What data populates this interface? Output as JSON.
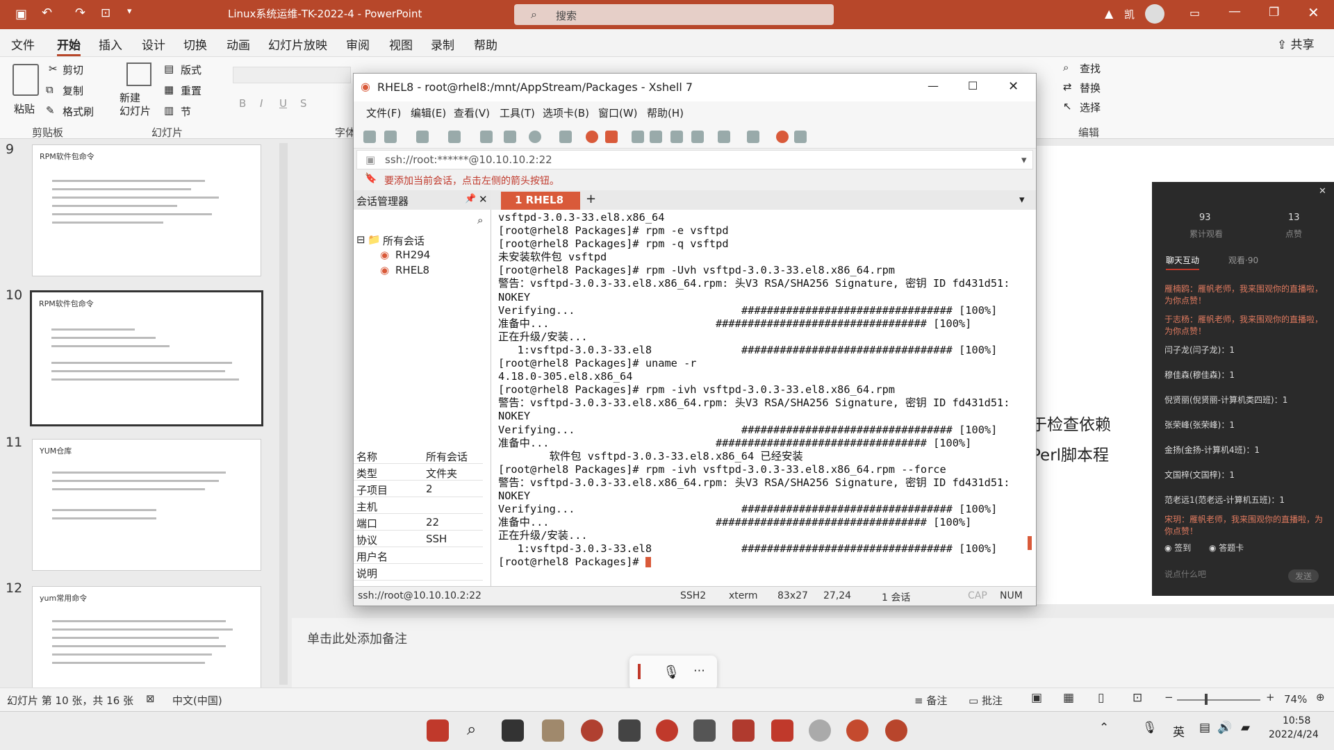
{
  "pp": {
    "title": "Linux系统运维-TK-2022-4  -  PowerPoint",
    "search": "搜索",
    "user": "凯",
    "share": "共享",
    "menu": [
      "文件",
      "开始",
      "插入",
      "设计",
      "切换",
      "动画",
      "幻灯片放映",
      "审阅",
      "视图",
      "录制",
      "帮助"
    ],
    "ribbon": {
      "paste": "粘贴",
      "cut": "剪切",
      "copy": "复制",
      "format_painter": "格式刷",
      "clipboard": "剪贴板",
      "new_slide": "新建\n幻灯片",
      "layout": "版式",
      "reset": "重置",
      "section": "节",
      "slides_group": "幻灯片",
      "font_group": "字体",
      "find": "查找",
      "replace": "替换",
      "select": "选择",
      "edit_group": "编辑"
    },
    "slides": [
      {
        "num": "9",
        "title": "RPM软件包命令"
      },
      {
        "num": "10",
        "title": "RPM软件包命令"
      },
      {
        "num": "11",
        "title": "YUM仓库"
      },
      {
        "num": "12",
        "title": "yum常用命令"
      }
    ],
    "notes_placeholder": "单击此处添加备注",
    "slide_text": [
      "于检查依赖",
      "Perl脚本程"
    ],
    "status": {
      "slide_count": "幻灯片 第 10 张，共 16 张",
      "language": "中文(中国)",
      "notes": "备注",
      "comments": "批注",
      "zoom": "74%"
    },
    "clock": {
      "time": "10:58",
      "date": "2022/4/24"
    },
    "ime": "英"
  },
  "xshell": {
    "title": "RHEL8 - root@rhel8:/mnt/AppStream/Packages - Xshell 7",
    "menu": [
      "文件(F)",
      "编辑(E)",
      "查看(V)",
      "工具(T)",
      "选项卡(B)",
      "窗口(W)",
      "帮助(H)"
    ],
    "address": "ssh://root:******@10.10.10.2:22",
    "hint": "要添加当前会话，点击左侧的箭头按钮。",
    "session_manager": "会话管理器",
    "tree": {
      "root": "所有会话",
      "items": [
        "RH294",
        "RHEL8"
      ]
    },
    "tab": "1 RHEL8",
    "props": [
      {
        "k": "名称",
        "v": "所有会话"
      },
      {
        "k": "类型",
        "v": "文件夹"
      },
      {
        "k": "子项目",
        "v": "2"
      },
      {
        "k": "主机",
        "v": ""
      },
      {
        "k": "端口",
        "v": "22"
      },
      {
        "k": "协议",
        "v": "SSH"
      },
      {
        "k": "用户名",
        "v": ""
      },
      {
        "k": "说明",
        "v": ""
      }
    ],
    "terminal": [
      "vsftpd-3.0.3-33.el8.x86_64",
      "[root@rhel8 Packages]# rpm -e vsftpd",
      "[root@rhel8 Packages]# rpm -q vsftpd",
      "未安装软件包 vsftpd",
      "[root@rhel8 Packages]# rpm -Uvh vsftpd-3.0.3-33.el8.x86_64.rpm",
      "警告：vsftpd-3.0.3-33.el8.x86_64.rpm: 头V3 RSA/SHA256 Signature, 密钥 ID fd431d51:",
      "NOKEY",
      "Verifying...                          ################################# [100%]",
      "准备中...                          ################################# [100%]",
      "正在升级/安装...",
      "   1:vsftpd-3.0.3-33.el8              ################################# [100%]",
      "[root@rhel8 Packages]# uname -r",
      "4.18.0-305.el8.x86_64",
      "[root@rhel8 Packages]# rpm -ivh vsftpd-3.0.3-33.el8.x86_64.rpm",
      "警告：vsftpd-3.0.3-33.el8.x86_64.rpm: 头V3 RSA/SHA256 Signature, 密钥 ID fd431d51:",
      "NOKEY",
      "Verifying...                          ################################# [100%]",
      "准备中...                          ################################# [100%]",
      "        软件包 vsftpd-3.0.3-33.el8.x86_64 已经安装",
      "[root@rhel8 Packages]# rpm -ivh vsftpd-3.0.3-33.el8.x86_64.rpm --force",
      "警告：vsftpd-3.0.3-33.el8.x86_64.rpm: 头V3 RSA/SHA256 Signature, 密钥 ID fd431d51:",
      "NOKEY",
      "Verifying...                          ################################# [100%]",
      "准备中...                          ################################# [100%]",
      "正在升级/安装...",
      "   1:vsftpd-3.0.3-33.el8              ################################# [100%]",
      "[root@rhel8 Packages]# "
    ],
    "status": {
      "conn": "ssh://root@10.10.10.2:22",
      "proto": "SSH2",
      "term": "xterm",
      "size": "83x27",
      "pos": "27,24",
      "sessions": "1 会话",
      "cap": "CAP",
      "num": "NUM"
    }
  },
  "chat": {
    "stats": [
      {
        "value": "93",
        "label": "累计观看"
      },
      {
        "value": "13",
        "label": "点赞"
      }
    ],
    "tabs": [
      "聊天互动",
      "观看·90"
    ],
    "messages": [
      "雁楠鸥：雁帆老师，我来围观你的直播啦，为你点赞！",
      "于志杨：雁帆老师，我来围观你的直播啦，为你点赞！",
      "闫子龙(闫子龙)：1",
      "穆佳森(穆佳森)：1",
      "倪贤丽(倪贤丽-计算机类四班)：1",
      "张荣峰(张荣峰)：1",
      "金扬(金扬-计算机4班)：1",
      "文国梓(文国梓)：1",
      "范老远1(范老远-计算机五班)：1",
      "宋玥：雁帆老师，我来围观你的直播啦，为你点赞！"
    ],
    "checkin": "签到",
    "answer": "答题卡",
    "input": "说点什么吧",
    "send": "发送"
  },
  "colors": {
    "ppt": "#b7472a",
    "xshell_tab": "#d95a3a",
    "chat_bg": "#2a2a2a"
  }
}
